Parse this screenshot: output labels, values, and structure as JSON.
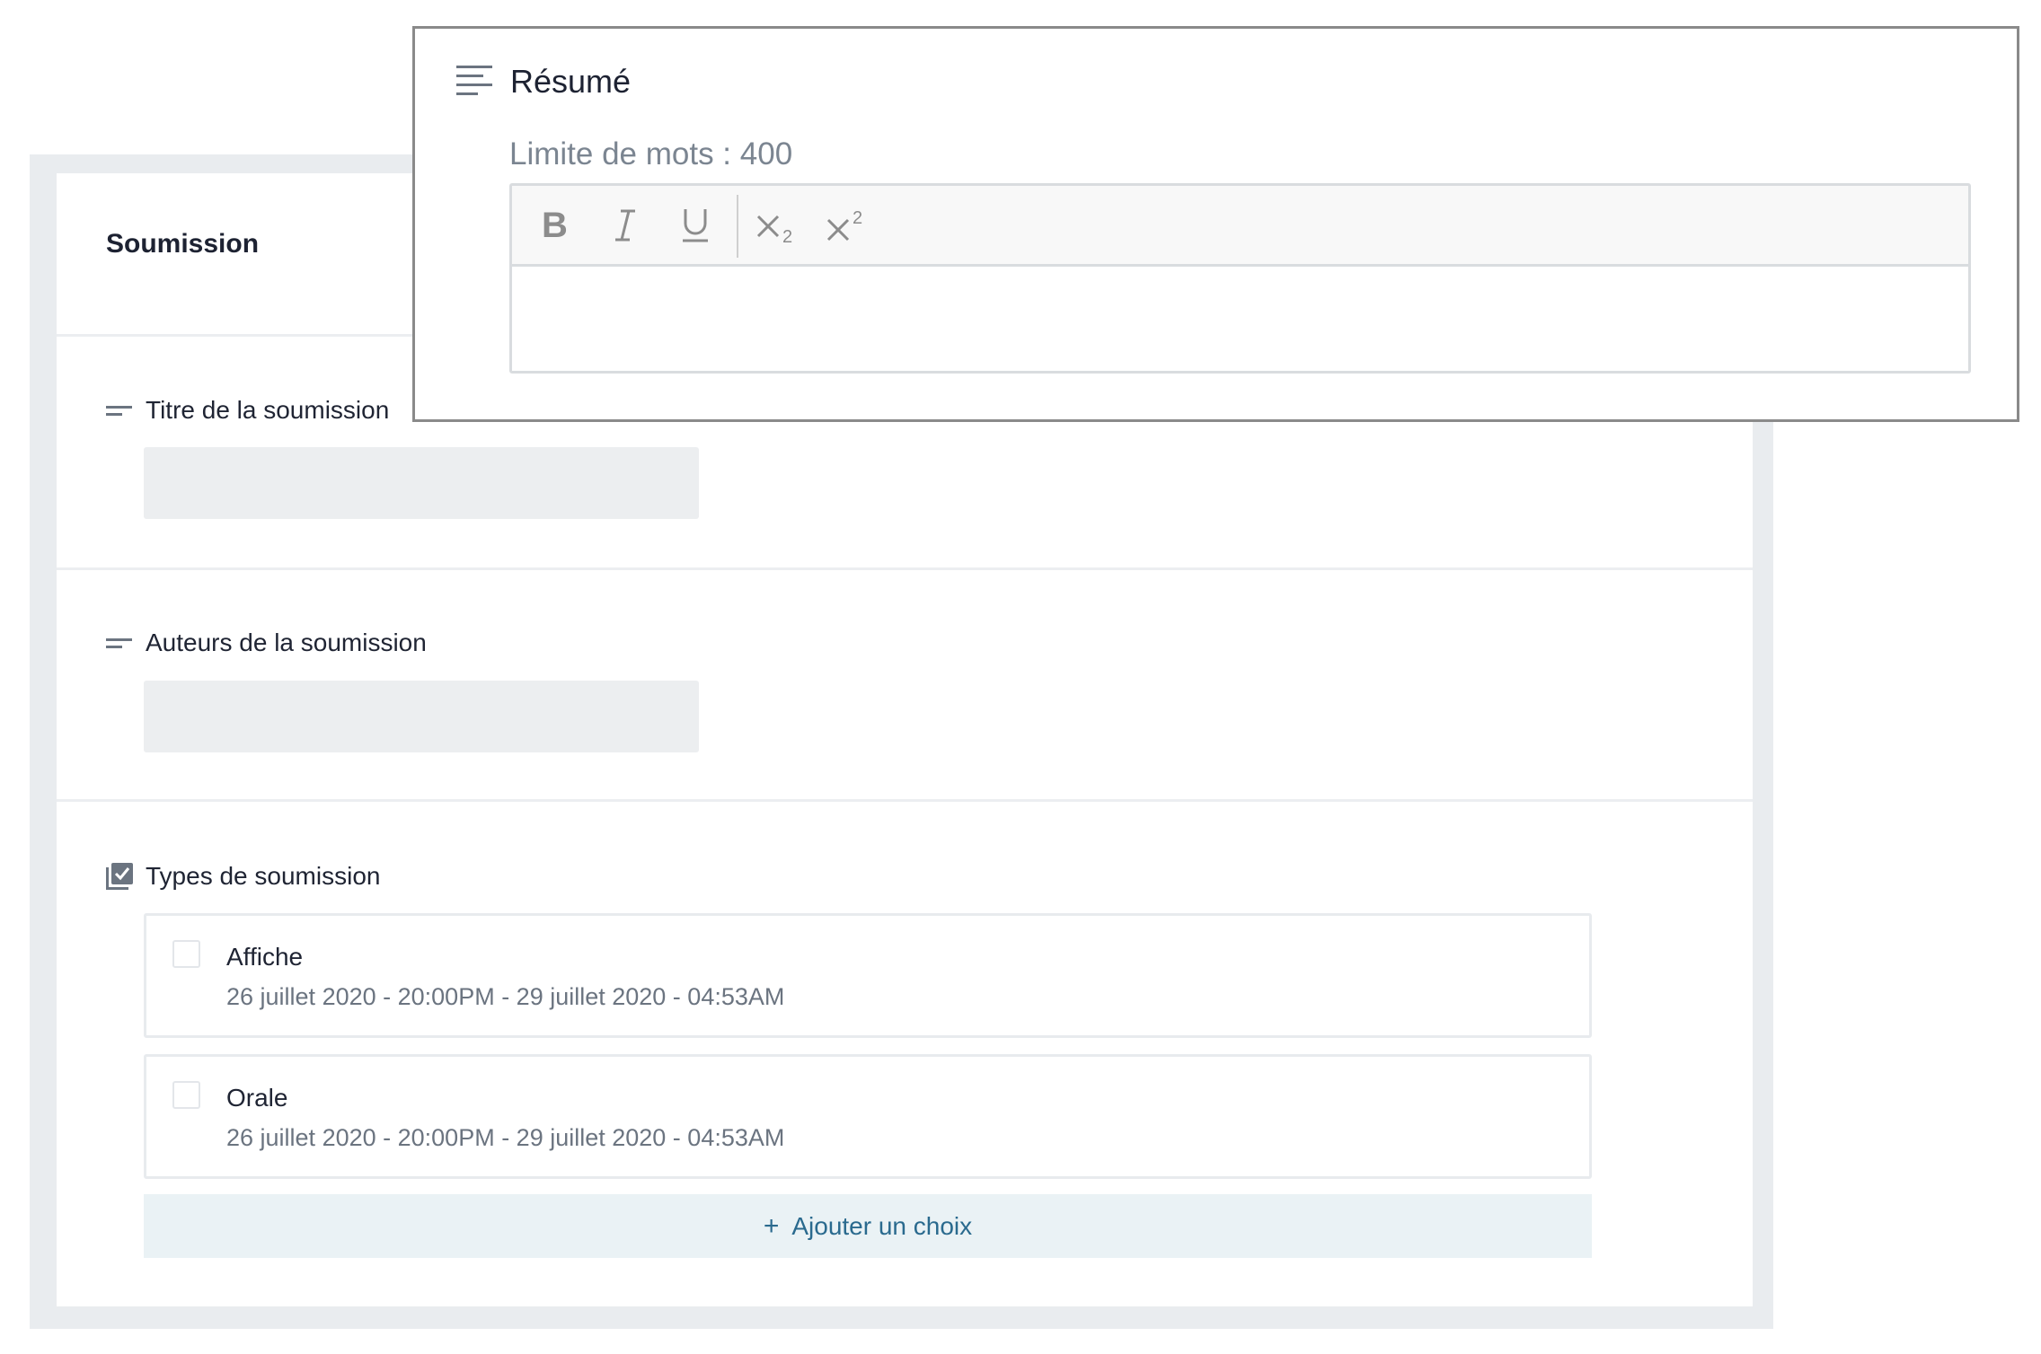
{
  "form": {
    "title": "Soumission",
    "fields": {
      "title_label": "Titre de la soumission",
      "title_value": "",
      "authors_label": "Auteurs de la soumission",
      "authors_value": "",
      "types_label": "Types de soumission"
    },
    "choices": [
      {
        "name": "Affiche",
        "dates": "26 juillet 2020 - 20:00PM - 29 juillet 2020 - 04:53AM",
        "checked": false
      },
      {
        "name": "Orale",
        "dates": "26 juillet 2020 - 20:00PM - 29 juillet 2020 - 04:53AM",
        "checked": false
      }
    ],
    "add_choice": {
      "icon": "+",
      "label": "Ajouter un choix"
    }
  },
  "abstract": {
    "title": "Résumé",
    "word_limit": "Limite de mots : 400",
    "content": "",
    "toolbar": [
      {
        "name": "bold",
        "icon": "bold-icon"
      },
      {
        "name": "italic",
        "icon": "italic-icon"
      },
      {
        "name": "underline",
        "icon": "underline-icon"
      },
      {
        "name": "subscript",
        "icon": "subscript-icon"
      },
      {
        "name": "superscript",
        "icon": "superscript-icon"
      }
    ]
  },
  "colors": {
    "accent": "#2a6a8e",
    "add_choice_bg": "#eaf2f5",
    "input_bg": "#eceef0",
    "muted_text": "#6b7480"
  }
}
